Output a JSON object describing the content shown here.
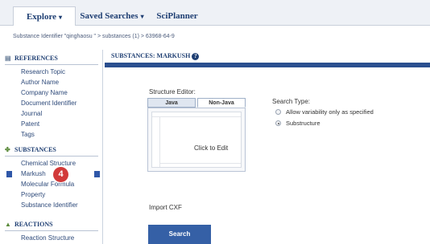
{
  "topnav": {
    "tabs": [
      {
        "label": "Explore",
        "caret": "▾"
      },
      {
        "label": "Saved Searches",
        "caret": "▾"
      },
      {
        "label": "SciPlanner",
        "caret": ""
      }
    ]
  },
  "breadcrumb": "Substance Identifier \"qinghaosu \" > substances (1) > 63968-64-9",
  "sidebar": {
    "sections": [
      {
        "title": "REFERENCES",
        "icon": "document-icon",
        "items": [
          "Research Topic",
          "Author Name",
          "Company Name",
          "Document Identifier",
          "Journal",
          "Patent",
          "Tags"
        ]
      },
      {
        "title": "SUBSTANCES",
        "icon": "molecule-icon",
        "items": [
          "Chemical Structure",
          "Markush",
          "Molecular Formula",
          "Property",
          "Substance Identifier"
        ]
      },
      {
        "title": "REACTIONS",
        "icon": "flask-icon",
        "items": [
          "Reaction Structure"
        ]
      }
    ],
    "badge": "4"
  },
  "main": {
    "title": "SUBSTANCES: MARKUSH",
    "help_icon": "?",
    "structure_editor_label": "Structure Editor:",
    "editor_tabs": [
      "Java",
      "Non-Java"
    ],
    "click_to_edit": "Click to Edit",
    "search_type_label": "Search Type:",
    "search_type_options": [
      {
        "label": "Allow variability only as specified",
        "selected": false
      },
      {
        "label": "Substructure",
        "selected": true
      }
    ],
    "import_cxf": "Import CXF",
    "search_button": "Search"
  },
  "colors": {
    "accent": "#2a4f8f",
    "button": "#3560a6",
    "badge": "#d23a3a"
  }
}
